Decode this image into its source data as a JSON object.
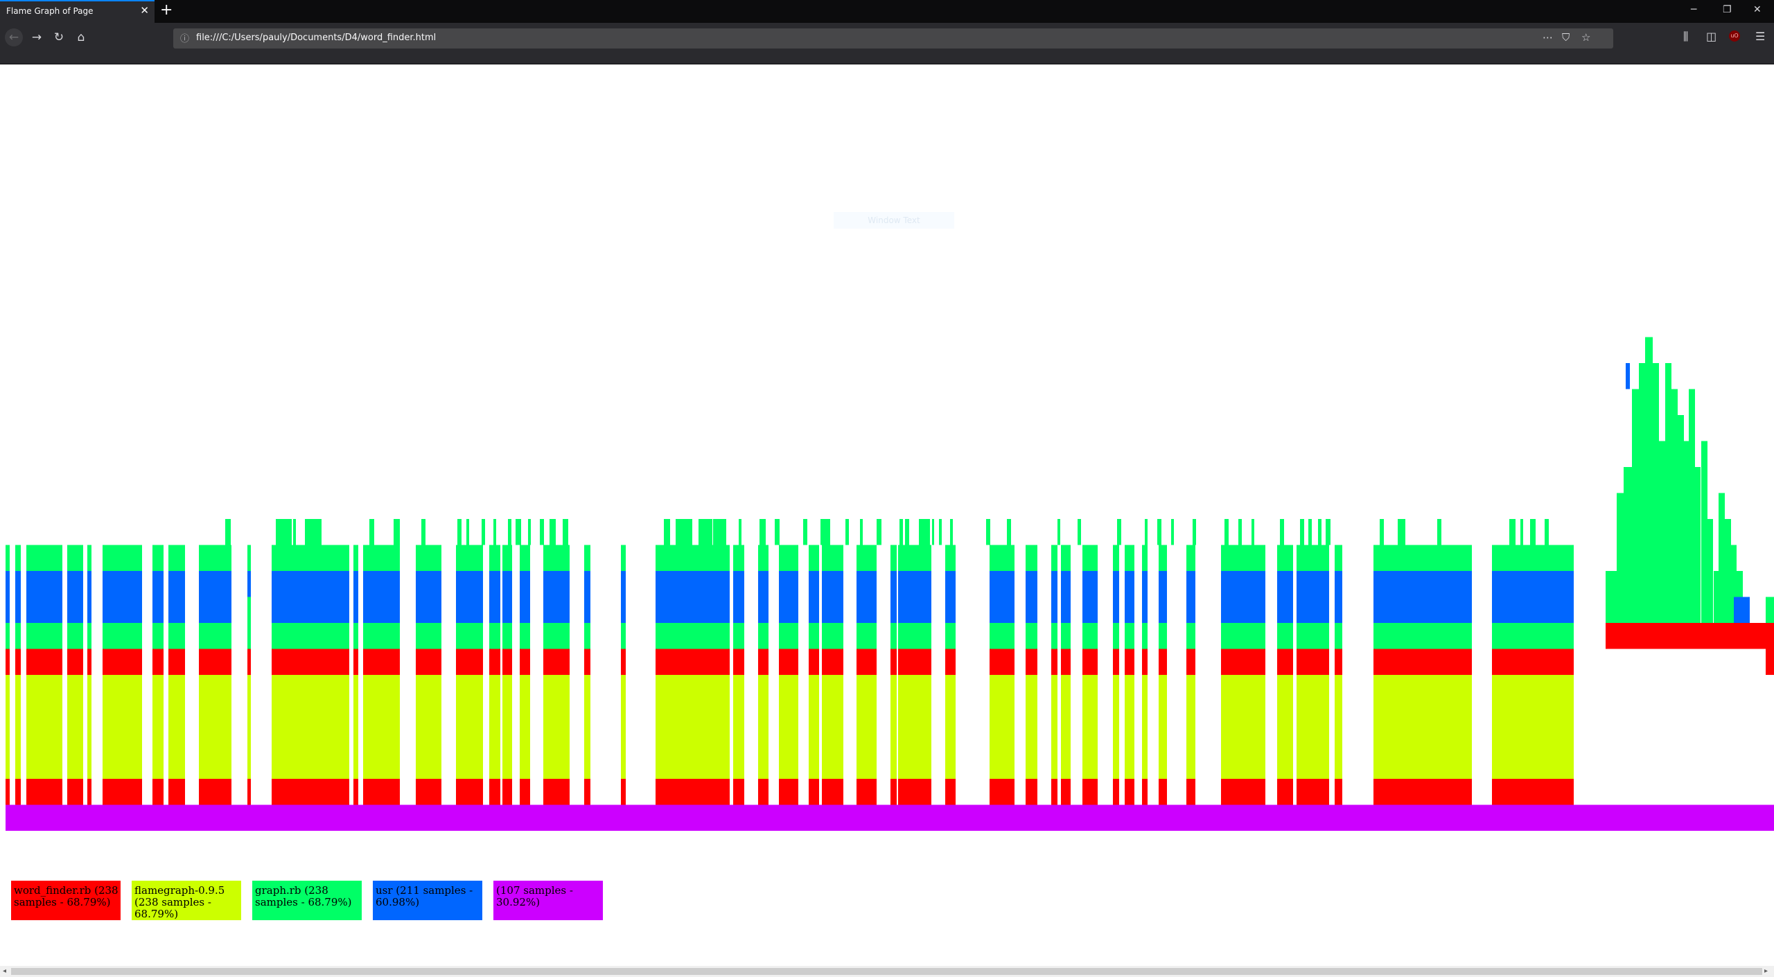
{
  "browser": {
    "tab_title": "Flame Graph of Page",
    "url": "file:///C:/Users/pauly/Documents/D4/word_finder.html"
  },
  "icons": {
    "tab_close": "close-icon",
    "new_tab": "plus-icon",
    "back": "back-arrow-icon",
    "forward": "forward-arrow-icon",
    "reload": "reload-icon",
    "home": "home-icon",
    "page_info": "info-icon",
    "page_actions": "more-icon",
    "pocket": "pocket-icon",
    "bookmark": "star-icon",
    "library": "library-icon",
    "sidebar": "sidebar-icon",
    "ublock": "ublock-icon",
    "menu": "hamburger-icon"
  },
  "tooltip": "Window Text",
  "colors": {
    "word_finder": "#ff0000",
    "flamegraph": "#ccff00",
    "graph": "#00ff66",
    "usr": "#0066ff",
    "root": "#cc00ff"
  },
  "legend": [
    {
      "label": "word_finder.rb (238 samples - 68.79%)",
      "color": "#ff0000"
    },
    {
      "label": "flamegraph-0.9.5 (238 samples - 68.79%)",
      "color": "#ccff00"
    },
    {
      "label": "graph.rb (238 samples - 68.79%)",
      "color": "#00ff66"
    },
    {
      "label": "usr (211 samples - 60.98%)",
      "color": "#0066ff"
    },
    {
      "label": "(107 samples - 30.92%)",
      "color": "#cc00ff"
    }
  ]
}
